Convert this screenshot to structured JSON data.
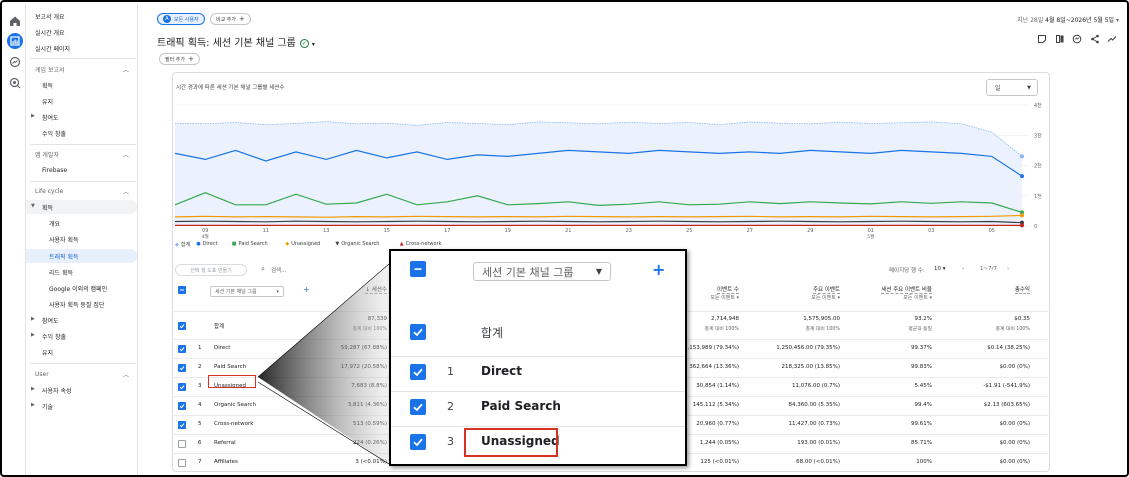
{
  "sidebar": {
    "top": [
      "보고서 개요",
      "실시간 개요",
      "실시간 페이지"
    ],
    "section_game": "게임 보고서",
    "game_items": [
      "획득",
      "유지",
      "참여도",
      "수익 창출"
    ],
    "section_dev": "앱 개발자",
    "dev_items": [
      "Firebase"
    ],
    "section_lifecycle": "Life cycle",
    "acq": "획득",
    "acq_items": [
      "개요",
      "사용자 획득",
      "트래픽 획득",
      "리드 획득",
      "Google 이외의 캠페인",
      "사용자 획득 동질 집단"
    ],
    "lc_items": [
      "참여도",
      "수익 창출",
      "유지"
    ],
    "section_user": "User",
    "user_items": [
      "사용자 속성",
      "기술"
    ]
  },
  "header": {
    "segment_chip": "모든 사용자",
    "compare_chip": "비교 추가",
    "date_prefix": "지난 28일",
    "date_range": "4월 8일~2026년 5월 5일",
    "title": "트래픽 획득: 세션 기본 채널 그룹",
    "filter_chip": "필터 추가"
  },
  "chart_panel": {
    "title": "시간 경과에 따른 세션 기본 채널 그룹별 세션수",
    "granularity": "일"
  },
  "chart_data": {
    "type": "line",
    "x": [
      "4월 8일",
      "4월 9일",
      "4월 10일",
      "4월 11일",
      "4월 12일",
      "4월 13일",
      "4월 14일",
      "4월 15일",
      "4월 16일",
      "4월 17일",
      "4월 18일",
      "4월 19일",
      "4월 20일",
      "4월 21일",
      "4월 22일",
      "4월 23일",
      "4월 24일",
      "4월 25일",
      "4월 26일",
      "4월 27일",
      "4월 28일",
      "4월 29일",
      "4월 30일",
      "5월 1일",
      "5월 2일",
      "5월 3일",
      "5월 4일",
      "5월 5일"
    ],
    "x_tick_labels": [
      "09",
      "11",
      "13",
      "15",
      "17",
      "19",
      "21",
      "23",
      "25",
      "27",
      "29",
      "01",
      "03",
      "05"
    ],
    "x_tick_sublabels": {
      "09": "4월",
      "01": "5월"
    },
    "y_tick_labels": [
      "4천",
      "3천",
      "2천",
      "1천",
      "0"
    ],
    "ylim": [
      0,
      4000
    ],
    "series": [
      {
        "name": "합계",
        "color": "#8ab4f8",
        "values": [
          3400,
          3380,
          3420,
          3350,
          3390,
          3450,
          3380,
          3400,
          3330,
          3420,
          3390,
          3350,
          3440,
          3410,
          3380,
          3430,
          3390,
          3420,
          3350,
          3440,
          3400,
          3380,
          3430,
          3390,
          3410,
          3440,
          3380,
          3100,
          2300
        ]
      },
      {
        "name": "Direct",
        "color": "#1a73e8",
        "values": [
          2400,
          2200,
          2500,
          2150,
          2450,
          2200,
          2500,
          2250,
          2450,
          2200,
          2350,
          2300,
          2400,
          2500,
          2450,
          2400,
          2500,
          2450,
          2400,
          2450,
          2400,
          2500,
          2450,
          2400,
          2500,
          2450,
          2400,
          2300,
          1650
        ]
      },
      {
        "name": "Paid Search",
        "color": "#34a853",
        "values": [
          700,
          1100,
          700,
          700,
          1050,
          720,
          760,
          1050,
          700,
          800,
          1000,
          700,
          740,
          800,
          680,
          720,
          800,
          700,
          720,
          800,
          740,
          800,
          760,
          730,
          800,
          750,
          800,
          760,
          450
        ]
      },
      {
        "name": "Unassigned",
        "color": "#f29900",
        "values": [
          300,
          320,
          300,
          310,
          300,
          290,
          310,
          300,
          320,
          310,
          300,
          310,
          300,
          320,
          310,
          300,
          310,
          300,
          310,
          320,
          300,
          310,
          300,
          320,
          310,
          300,
          310,
          320,
          350
        ]
      },
      {
        "name": "Organic Search",
        "color": "#3c4043",
        "values": [
          150,
          160,
          150,
          140,
          160,
          150,
          140,
          150,
          160,
          150,
          140,
          150,
          160,
          150,
          140,
          150,
          160,
          150,
          140,
          150,
          160,
          150,
          140,
          150,
          160,
          150,
          140,
          150,
          110
        ]
      },
      {
        "name": "Cross-network",
        "color": "#c5221f",
        "values": [
          20,
          20,
          20,
          20,
          20,
          20,
          20,
          20,
          20,
          20,
          20,
          20,
          20,
          20,
          20,
          20,
          20,
          20,
          20,
          20,
          20,
          20,
          20,
          20,
          20,
          20,
          20,
          20,
          20
        ]
      }
    ]
  },
  "table_tools": {
    "plot_button": "선택 행 도표 만들기",
    "search_placeholder": "검색...",
    "rows_per_page_label": "페이지당 행 수:",
    "rows_per_page": "10",
    "pagination": "1~7/7"
  },
  "table": {
    "dim_header": "세션 기본 채널 그룹",
    "columns": [
      {
        "label": "세션수",
        "sub": ""
      },
      {
        "label": "이벤트 수",
        "sub": "모든 이벤트"
      },
      {
        "label": "주요 이벤트",
        "sub": "모든 이벤트"
      },
      {
        "label": "세션 주요 이벤트 비율",
        "sub": "모든 이벤트"
      },
      {
        "label": "총수익",
        "sub": ""
      }
    ],
    "total": {
      "label": "합계",
      "values": [
        "87,339",
        "2,714,948",
        "1,575,905.00",
        "93.2%",
        "$0.35"
      ],
      "subs": [
        "총계 대비 100%",
        "총계 대비 100%",
        "총계 대비 100%",
        "평균과 동일",
        "총계 대비 100%"
      ]
    },
    "rows": [
      {
        "idx": "1",
        "name": "Direct",
        "checked": true,
        "values": [
          "59,287 (67.88%)",
          "2,153,989 (79.34%)",
          "1,250,456.00 (79.35%)",
          "99.37%",
          "$0.14 (38.25%)"
        ]
      },
      {
        "idx": "2",
        "name": "Paid Search",
        "checked": true,
        "values": [
          "17,972 (20.58%)",
          "362,664 (13.36%)",
          "218,325.00 (13.85%)",
          "99.83%",
          "$0.00 (0%)"
        ]
      },
      {
        "idx": "3",
        "name": "Unassigned",
        "checked": true,
        "values": [
          "7,683 (8.8%)",
          "30,854 (1.14%)",
          "11,076.00 (0.7%)",
          "5.45%",
          "-$1.91 (-541.9%)"
        ]
      },
      {
        "idx": "4",
        "name": "Organic Search",
        "checked": true,
        "values": [
          "3,811 (4.36%)",
          "145,112 (5.34%)",
          "84,360.00 (5.35%)",
          "99.4%",
          "$2.13 (603.65%)"
        ]
      },
      {
        "idx": "5",
        "name": "Cross-network",
        "checked": true,
        "values": [
          "513 (0.59%)",
          "20,960 (0.77%)",
          "11,427.00 (0.73%)",
          "99.61%",
          "$0.00 (0%)"
        ]
      },
      {
        "idx": "6",
        "name": "Referral",
        "checked": false,
        "values": [
          "224 (0.26%)",
          "1,244 (0.05%)",
          "193.00 (0.01%)",
          "85.71%",
          "$0.00 (0%)"
        ]
      },
      {
        "idx": "7",
        "name": "Affiliates",
        "checked": false,
        "values": [
          "3 (<0.01%)",
          "125 (<0.01%)",
          "68.00 (<0.01%)",
          "100%",
          "$0.00 (0%)"
        ]
      }
    ]
  },
  "zoom": {
    "dropdown": "세션 기본 채널 그룹",
    "total_label": "합계",
    "rows": [
      {
        "idx": "1",
        "name": "Direct"
      },
      {
        "idx": "2",
        "name": "Paid Search"
      },
      {
        "idx": "3",
        "name": "Unassigned"
      }
    ]
  },
  "colors": {
    "accent": "#1a73e8",
    "highlight": "#d93025"
  }
}
